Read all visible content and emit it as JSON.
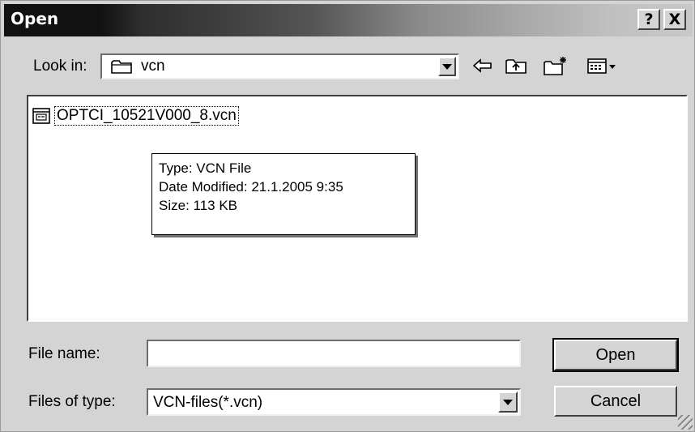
{
  "dialog": {
    "title": "Open",
    "help_button": "?",
    "close_button": "X"
  },
  "look_in": {
    "label": "Look in:",
    "value": "vcn",
    "icons": [
      "folder-icon",
      "back-arrow-icon",
      "up-folder-icon",
      "new-folder-icon",
      "view-menu-icon"
    ]
  },
  "files": [
    {
      "name": "OPTCI_10521V000_8.vcn",
      "icon": "vcn-file-icon"
    }
  ],
  "tooltip": {
    "type": "Type: VCN File",
    "modified": "Date Modified: 21.1.2005 9:35",
    "size": "Size: 113 KB"
  },
  "file_name": {
    "label": "File name:",
    "value": ""
  },
  "file_type": {
    "label": "Files of type:",
    "value": "VCN-files(*.vcn)"
  },
  "buttons": {
    "open": "Open",
    "cancel": "Cancel"
  }
}
